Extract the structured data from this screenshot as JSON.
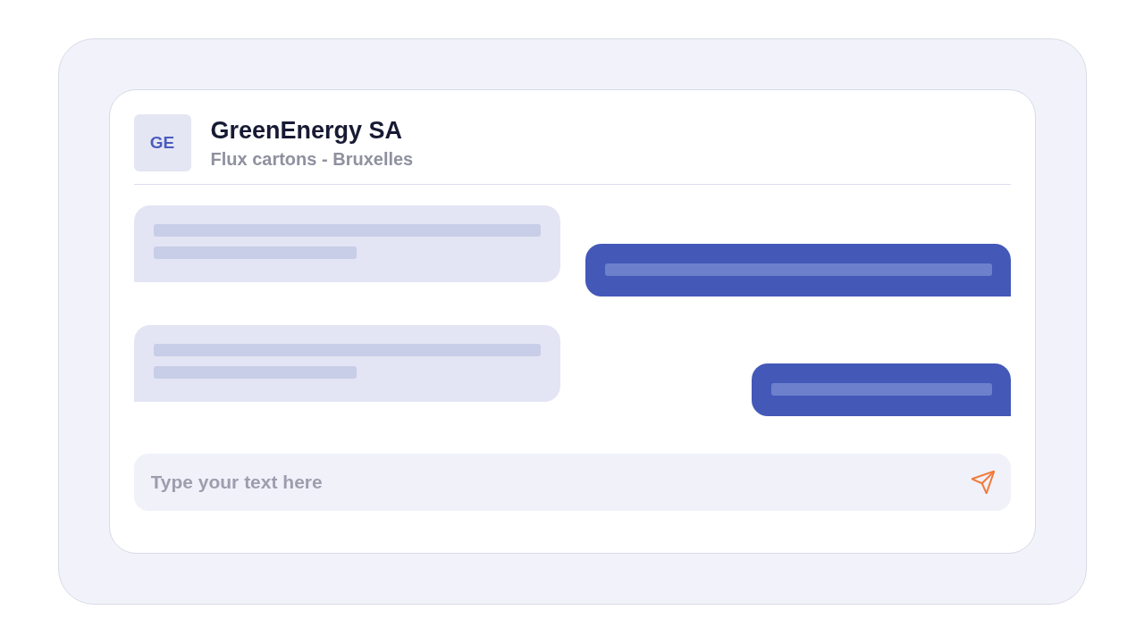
{
  "conversation": {
    "avatar_initials": "GE",
    "name": "GreenEnergy SA",
    "subtitle": "Flux cartons - Bruxelles"
  },
  "messages": [
    {
      "kind": "received",
      "lines": [
        {
          "kind": "long"
        },
        {
          "kind": "short"
        }
      ]
    },
    {
      "kind": "sent",
      "lines": [
        {
          "kind": "long"
        }
      ]
    },
    {
      "kind": "received",
      "lines": [
        {
          "kind": "long"
        },
        {
          "kind": "short"
        }
      ]
    },
    {
      "kind": "sent",
      "lines": [
        {
          "kind": "medium"
        }
      ]
    }
  ],
  "composer": {
    "placeholder": "Type your text here"
  }
}
